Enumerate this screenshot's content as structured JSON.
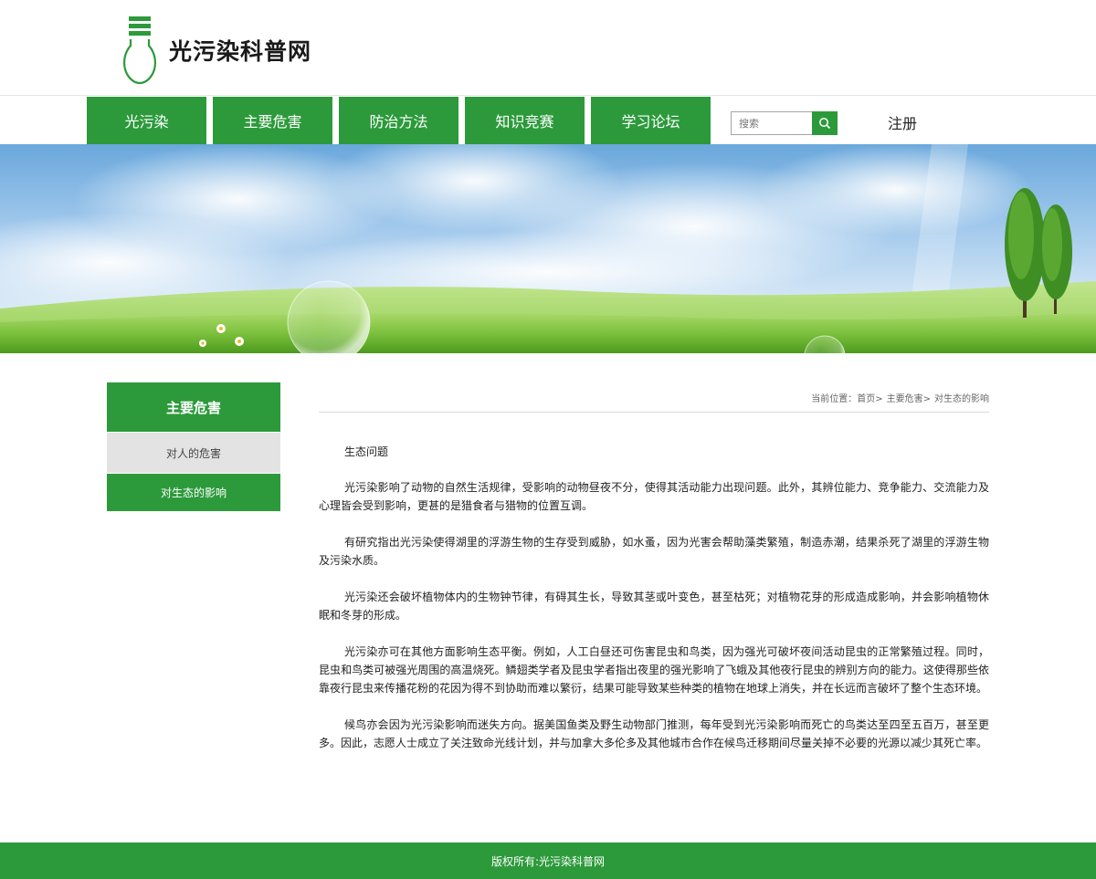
{
  "site": {
    "title": "光污染科普网"
  },
  "nav": {
    "items": [
      {
        "label": "光污染"
      },
      {
        "label": "主要危害"
      },
      {
        "label": "防治方法"
      },
      {
        "label": "知识竞赛"
      },
      {
        "label": "学习论坛"
      }
    ],
    "search_placeholder": "搜索",
    "register_label": "注册"
  },
  "sidebar": {
    "title": "主要危害",
    "items": [
      {
        "label": "对人的危害"
      },
      {
        "label": "对生态的影响"
      }
    ]
  },
  "breadcrumb": {
    "prefix": "当前位置：",
    "items": [
      "首页>",
      "主要危害>",
      "对生态的影响"
    ]
  },
  "article": {
    "heading": "生态问题",
    "paragraphs": [
      "光污染影响了动物的自然生活规律，受影响的动物昼夜不分，使得其活动能力出现问题。此外，其辨位能力、竞争能力、交流能力及心理皆会受到影响，更甚的是猎食者与猎物的位置互调。",
      "有研究指出光污染使得湖里的浮游生物的生存受到威胁，如水蚤，因为光害会帮助藻类繁殖，制造赤潮，结果杀死了湖里的浮游生物及污染水质。",
      "光污染还会破坏植物体内的生物钟节律，有碍其生长，导致其茎或叶变色，甚至枯死；对植物花芽的形成造成影响，并会影响植物休眠和冬芽的形成。",
      "光污染亦可在其他方面影响生态平衡。例如，人工白昼还可伤害昆虫和鸟类，因为强光可破坏夜间活动昆虫的正常繁殖过程。同时，昆虫和鸟类可被强光周围的高温烧死。鳞翅类学者及昆虫学者指出夜里的强光影响了飞蛾及其他夜行昆虫的辨别方向的能力。这使得那些依靠夜行昆虫来传播花粉的花因为得不到协助而难以繁衍，结果可能导致某些种类的植物在地球上消失，并在长远而言破坏了整个生态环境。",
      "候鸟亦会因为光污染影响而迷失方向。据美国鱼类及野生动物部门推测，每年受到光污染影响而死亡的鸟类达至四至五百万，甚至更多。因此，志愿人士成立了关注致命光线计划，并与加拿大多伦多及其他城市合作在候鸟迁移期间尽量关掉不必要的光源以减少其死亡率。"
    ]
  },
  "footer": {
    "text": "版权所有:光污染科普网"
  },
  "colors": {
    "brand_green": "#2c9a3b",
    "sidebar_gray": "#e3e3e3"
  }
}
